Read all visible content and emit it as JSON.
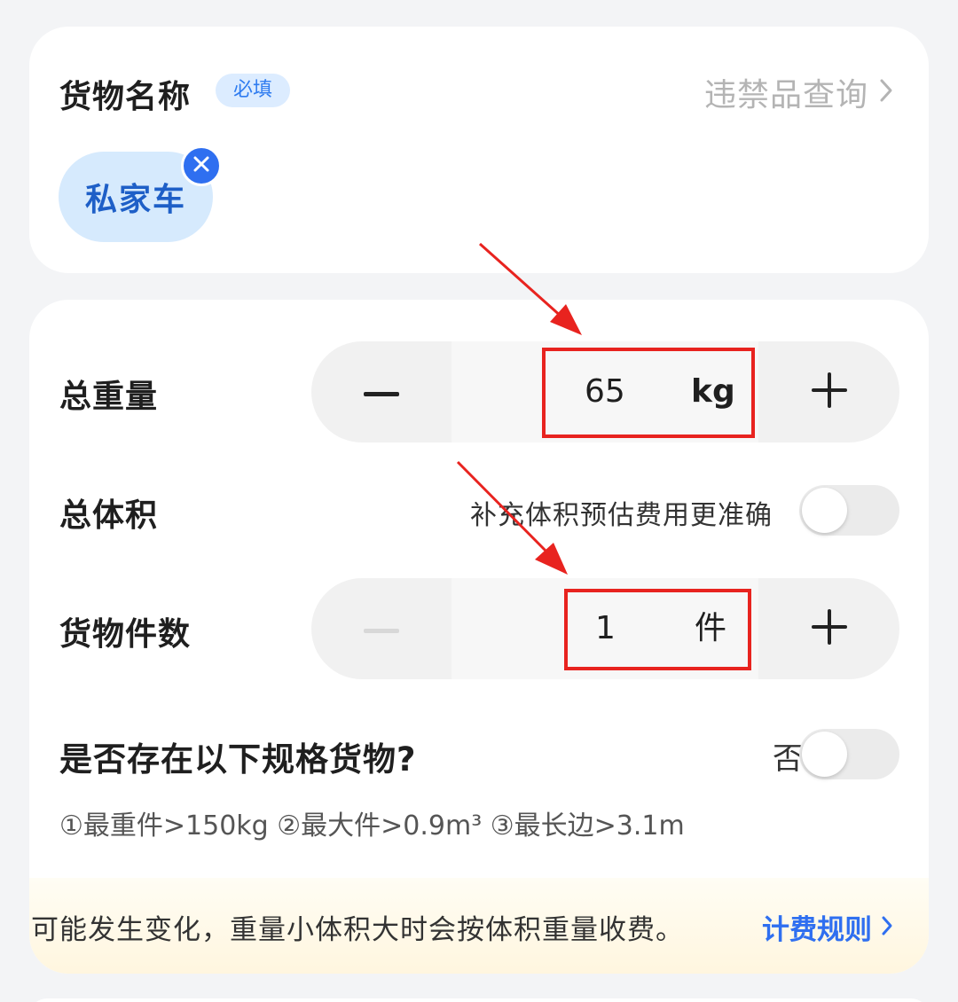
{
  "cargo_name": {
    "title": "货物名称",
    "required_badge": "必填",
    "banned_items_link": "违禁品查询",
    "selected_tag": "私家车"
  },
  "weight": {
    "label": "总重量",
    "value": "65",
    "unit": "kg"
  },
  "volume": {
    "label": "总体积",
    "hint": "补充体积预估费用更准确",
    "toggle_on": false
  },
  "pieces": {
    "label": "货物件数",
    "value": "1",
    "unit": "件"
  },
  "special_spec": {
    "question": "是否存在以下规格货物?",
    "value": "否",
    "toggle_on": false,
    "criteria": "①最重件>150kg ②最大件>0.9m³ ③最长边>3.1m"
  },
  "notice": {
    "text": "可能发生变化，重量小体积大时会按体积重量收费。",
    "link": "计费规则"
  },
  "colors": {
    "accent": "#2f6ff0",
    "highlight": "#e8231f",
    "toggle_off": "#ebebeb"
  }
}
